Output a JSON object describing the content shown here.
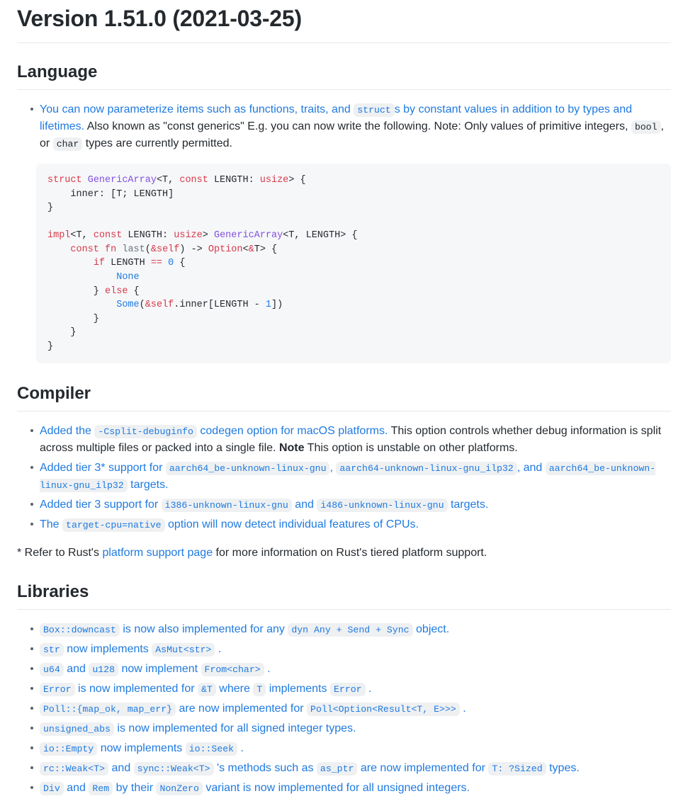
{
  "release": {
    "title": "Version 1.51.0 (2021-03-25)"
  },
  "sections": {
    "language": {
      "heading": "Language",
      "bullet1": {
        "link_part_a": "You can now parameterize items such as functions, traits, and",
        "code_struct": "struct",
        "link_part_b": "s by constant values in addition to by types and lifetimes.",
        "text_a": "Also known as \"const generics\" E.g. you can now write the following. Note: Only values of primitive integers,",
        "code_bool": "bool",
        "text_b": ", or",
        "code_char": "char",
        "text_c": "types are currently permitted."
      },
      "code_block": {
        "lines": [
          "struct GenericArray<T, const LENGTH: usize> {",
          "    inner: [T; LENGTH]",
          "}",
          "",
          "impl<T, const LENGTH: usize> GenericArray<T, LENGTH> {",
          "    const fn last(&self) -> Option<&T> {",
          "        if LENGTH == 0 {",
          "            None",
          "        } else {",
          "            Some(&self.inner[LENGTH - 1])",
          "        }",
          "    }",
          "}"
        ]
      }
    },
    "compiler": {
      "heading": "Compiler",
      "bullets": [
        {
          "link_a": "Added the",
          "code_1": "-Csplit-debuginfo",
          "link_b": "codegen option for macOS platforms.",
          "text_a": "This option controls whether debug information is split across multiple files or packed into a single file.",
          "note_label": "Note",
          "text_b": "This option is unstable on other platforms."
        },
        {
          "link_a": "Added tier 3* support for",
          "code_1": "aarch64_be-unknown-linux-gnu",
          "sep_1": ",",
          "code_2": "aarch64-unknown-linux-gnu_ilp32",
          "sep_2": ", and",
          "code_3": "aarch64_be-unknown-linux-gnu_ilp32",
          "link_b": "targets."
        },
        {
          "link_a": "Added tier 3 support for",
          "code_1": "i386-unknown-linux-gnu",
          "sep_1": "and",
          "code_2": "i486-unknown-linux-gnu",
          "link_b": "targets."
        },
        {
          "link_a": "The",
          "code_1": "target-cpu=native",
          "link_b": "option will now detect individual features of CPUs."
        }
      ],
      "footnote": {
        "text_a": "* Refer to Rust's",
        "link_text": "platform support page",
        "text_b": "for more information on Rust's tiered platform support."
      }
    },
    "libraries": {
      "heading": "Libraries",
      "bullets": [
        {
          "code_1": "Box::downcast",
          "mid_1": "is now also implemented for any",
          "code_2": "dyn Any + Send + Sync",
          "tail": "object."
        },
        {
          "code_1": "str",
          "mid_1": "now implements",
          "code_2": "AsMut<str>",
          "tail": "."
        },
        {
          "code_1": "u64",
          "mid_1": "and",
          "code_2": "u128",
          "mid_2": "now implement",
          "code_3": "From<char>",
          "tail": "."
        },
        {
          "code_1": "Error",
          "mid_1": "is now implemented for",
          "code_2": "&T",
          "mid_2": "where",
          "code_3": "T",
          "mid_3": "implements",
          "code_4": "Error",
          "tail": "."
        },
        {
          "code_1": "Poll::{map_ok, map_err}",
          "mid_1": "are now implemented for",
          "code_2": "Poll<Option<Result<T, E>>>",
          "tail": "."
        },
        {
          "code_1": "unsigned_abs",
          "tail": "is now implemented for all signed integer types."
        },
        {
          "code_1": "io::Empty",
          "mid_1": "now implements",
          "code_2": "io::Seek",
          "tail": "."
        },
        {
          "code_1": "rc::Weak<T>",
          "mid_1": "and",
          "code_2": "sync::Weak<T>",
          "mid_2": "'s methods such as",
          "code_3": "as_ptr",
          "mid_3": "are now implemented for",
          "code_4": "T: ?Sized",
          "tail": "types."
        },
        {
          "code_1": "Div",
          "mid_1": "and",
          "code_2": "Rem",
          "mid_2": "by their",
          "code_3": "NonZero",
          "tail": "variant is now implemented for all unsigned integers."
        }
      ]
    }
  },
  "colors": {
    "link": "#1f7ae0",
    "text": "#24292e",
    "code_bg": "#eef0f2",
    "codeblock_bg": "#f6f7f9",
    "rule": "#e6e8eb",
    "kw_red": "#d73a49",
    "type_purple": "#8250df"
  }
}
